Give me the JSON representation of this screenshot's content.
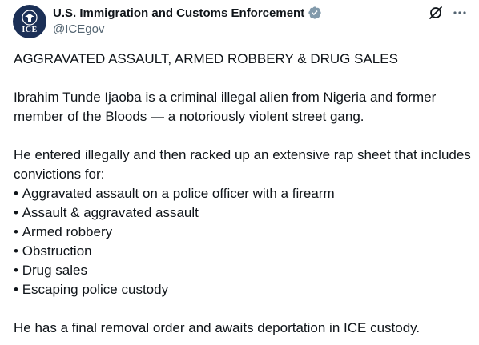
{
  "author": {
    "display_name": "U.S. Immigration and Customs Enforcement",
    "handle": "@ICEgov",
    "avatar_text": "ICE",
    "verified_icon": "verified-badge-icon",
    "colors": {
      "verified": "#829aab",
      "avatar_bg": "#1b2f56"
    }
  },
  "header_actions": [
    {
      "icon": "grok-icon"
    },
    {
      "icon": "more-options-icon"
    }
  ],
  "tweet": {
    "headline": "AGGRAVATED ASSAULT, ARMED ROBBERY & DRUG SALES",
    "paragraph_1": "Ibrahim Tunde Ijaoba is a criminal illegal alien from Nigeria and former member of the Bloods — a notoriously violent street gang.",
    "paragraph_2_intro": "He entered illegally and then racked up an extensive rap sheet that includes convictions for:",
    "convictions": [
      "Aggravated assault on a police officer with a firearm",
      "Assault & aggravated assault",
      "Armed robbery",
      "Obstruction",
      "Drug sales",
      "Escaping police custody"
    ],
    "closing": "He has a final removal order and awaits deportation in ICE custody."
  }
}
